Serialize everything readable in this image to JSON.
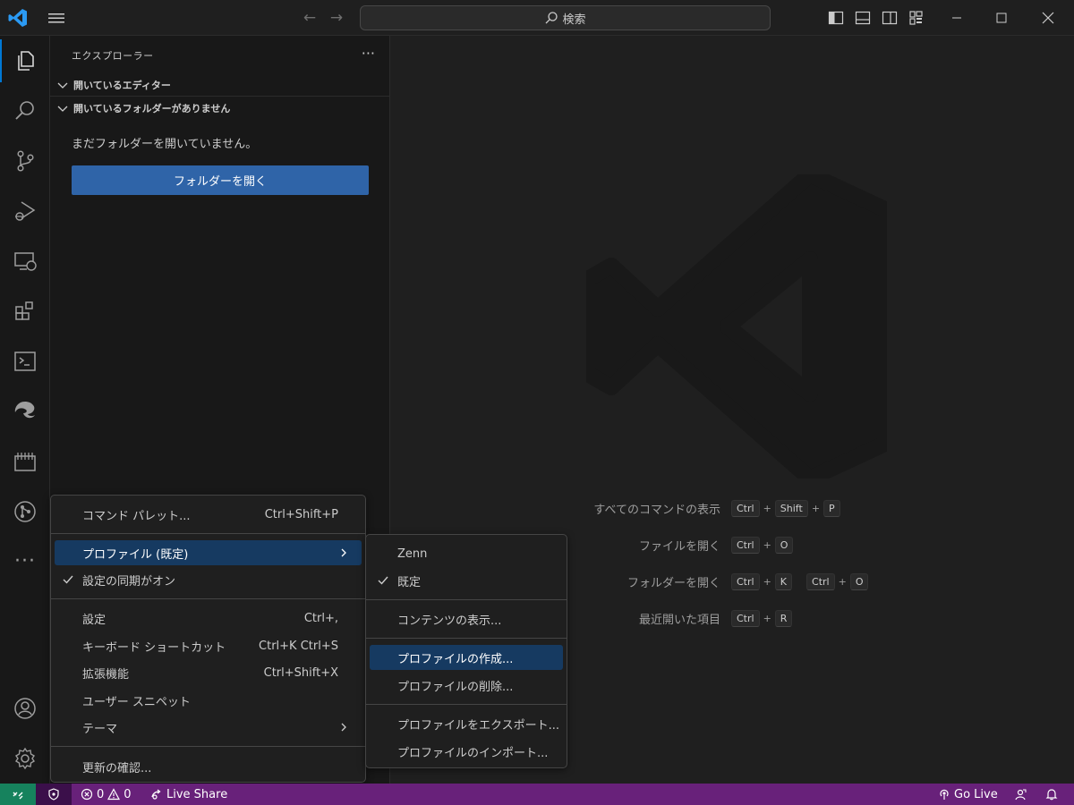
{
  "titlebar": {
    "search_label": "検索"
  },
  "sidebar": {
    "title": "エクスプローラー",
    "sections": [
      {
        "label": "開いているエディター"
      },
      {
        "label": "開いているフォルダーがありません"
      }
    ],
    "empty_message": "まだフォルダーを開いていません。",
    "open_folder_button": "フォルダーを開く"
  },
  "editor": {
    "shortcuts": [
      {
        "label": "すべてのコマンドの表示",
        "chords": [
          [
            "Ctrl",
            "Shift",
            "P"
          ]
        ]
      },
      {
        "label": "ファイルを開く",
        "chords": [
          [
            "Ctrl",
            "O"
          ]
        ]
      },
      {
        "label": "フォルダーを開く",
        "chords": [
          [
            "Ctrl",
            "K"
          ],
          [
            "Ctrl",
            "O"
          ]
        ]
      },
      {
        "label": "最近開いた項目",
        "chords": [
          [
            "Ctrl",
            "R"
          ]
        ]
      }
    ]
  },
  "manage_menu": {
    "items": [
      {
        "label": "コマンド パレット...",
        "shortcut": "Ctrl+Shift+P"
      },
      {
        "label": "プロファイル (既定)",
        "submenu": true,
        "highlighted": true
      },
      {
        "label": "設定の同期がオン",
        "checked": true
      },
      {
        "label": "設定",
        "shortcut": "Ctrl+,"
      },
      {
        "label": "キーボード ショートカット",
        "shortcut": "Ctrl+K Ctrl+S"
      },
      {
        "label": "拡張機能",
        "shortcut": "Ctrl+Shift+X"
      },
      {
        "label": "ユーザー スニペット"
      },
      {
        "label": "テーマ",
        "submenu": true
      },
      {
        "label": "更新の確認..."
      }
    ]
  },
  "profile_menu": {
    "items": [
      {
        "label": "Zenn"
      },
      {
        "label": "既定",
        "checked": true
      },
      {
        "label": "コンテンツの表示..."
      },
      {
        "label": "プロファイルの作成...",
        "highlighted": true
      },
      {
        "label": "プロファイルの削除..."
      },
      {
        "label": "プロファイルをエクスポート..."
      },
      {
        "label": "プロファイルのインポート..."
      }
    ]
  },
  "statusbar": {
    "errors": "0",
    "warnings": "0",
    "live_share": "Live Share",
    "go_live": "Go Live"
  },
  "colors": {
    "statusbar": "#68217a",
    "remote": "#16825d",
    "accent_button": "#2f64a8",
    "menu_highlight": "#163a61"
  }
}
